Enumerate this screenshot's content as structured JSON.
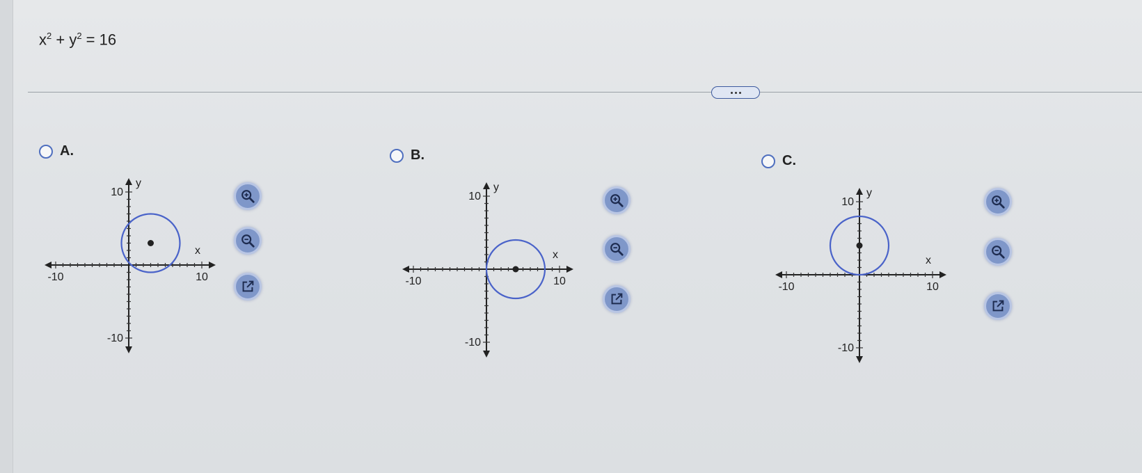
{
  "question": {
    "equation_base_x": "x",
    "equation_exp_x": "2",
    "equation_plus": " + ",
    "equation_base_y": "y",
    "equation_exp_y": "2",
    "equation_rhs": " = 16"
  },
  "more_button": {
    "label": "..."
  },
  "options": [
    {
      "label": "A.",
      "circle_center": [
        3,
        3
      ],
      "radius": 4
    },
    {
      "label": "B.",
      "circle_center": [
        4,
        0
      ],
      "radius": 4
    },
    {
      "label": "C.",
      "circle_center": [
        0,
        4
      ],
      "radius": 4
    }
  ],
  "axes": {
    "x_label": "x",
    "y_label": "y",
    "x_min_label": "-10",
    "x_max_label": "10",
    "y_max_label": "10",
    "y_min_label": "-10",
    "range": [
      -10,
      10
    ]
  },
  "tools": {
    "zoom_in_icon": "zoom-in-icon",
    "zoom_out_icon": "zoom-out-icon",
    "popout_icon": "external-link-icon"
  },
  "colors": {
    "circle": "#4a63c9",
    "radio_border": "#4f6fbf",
    "tool_bg": "#7f97c9"
  }
}
